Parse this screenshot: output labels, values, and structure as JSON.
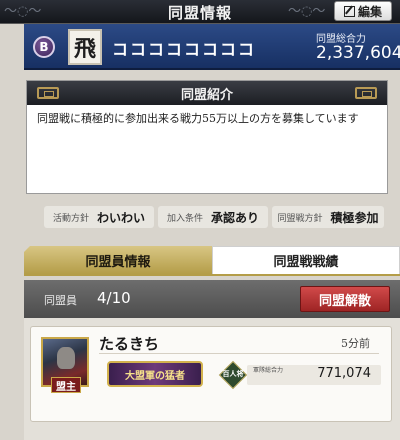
{
  "header": {
    "title": "同盟情報",
    "edit_label": "編集"
  },
  "alliance": {
    "rank": "B",
    "emblem_char": "飛",
    "name": "ココココココココ",
    "power_label": "同盟総合力",
    "power_value": "2,337,604"
  },
  "intro": {
    "title": "同盟紹介",
    "text": "同盟戦に積極的に参加出来る戦力55万以上の方を募集しています"
  },
  "info": [
    {
      "label": "活動方針",
      "value": "わいわい"
    },
    {
      "label": "加入条件",
      "value": "承認あり"
    },
    {
      "label": "同盟戦方針",
      "value": "積極参加"
    }
  ],
  "tabs": [
    {
      "label": "同盟員情報",
      "active": true
    },
    {
      "label": "同盟戦戦績",
      "active": false
    }
  ],
  "members": {
    "label": "同盟員",
    "count": "4/10",
    "disband_label": "同盟解散"
  },
  "member_list": [
    {
      "name": "たるきち",
      "last_login": "5分前",
      "role": "盟主",
      "title_badge": "大盟軍の猛者",
      "rank_badge": "百人将",
      "stat_label": "軍隊総合力",
      "stat_value": "771,074"
    }
  ],
  "colors": {
    "header_bg": "#1c1e23",
    "banner_bg": "#1f3a73",
    "accent_gold": "#b49d48",
    "disband_red": "#b83232"
  }
}
